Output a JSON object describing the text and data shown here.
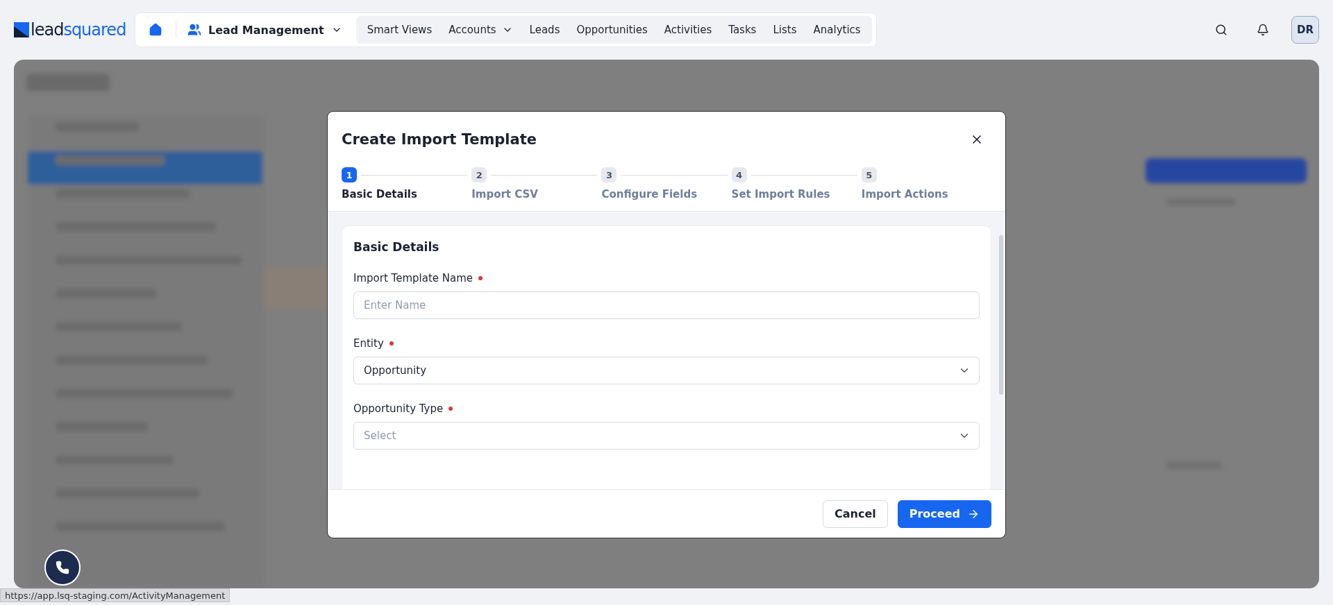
{
  "nav": {
    "logo_parts": [
      "lead",
      "squared"
    ],
    "app": "Lead Management",
    "items": [
      {
        "label": "Smart Views",
        "dropdown": false
      },
      {
        "label": "Accounts",
        "dropdown": true
      },
      {
        "label": "Leads",
        "dropdown": false
      },
      {
        "label": "Opportunities",
        "dropdown": false
      },
      {
        "label": "Activities",
        "dropdown": false
      },
      {
        "label": "Tasks",
        "dropdown": false
      },
      {
        "label": "Lists",
        "dropdown": false
      },
      {
        "label": "Analytics",
        "dropdown": false
      }
    ],
    "user_initials": "DR"
  },
  "dialog": {
    "title": "Create Import Template",
    "steps": [
      {
        "number": "1",
        "label": "Basic Details",
        "selected": true
      },
      {
        "number": "2",
        "label": "Import CSV",
        "selected": false
      },
      {
        "number": "3",
        "label": "Configure Fields",
        "selected": false
      },
      {
        "number": "4",
        "label": "Set Import Rules",
        "selected": false
      },
      {
        "number": "5",
        "label": "Import Actions",
        "selected": false
      }
    ],
    "section_title": "Basic Details",
    "fields": [
      {
        "kind": "text",
        "label": "Import Template Name",
        "required": true,
        "placeholder": "Enter Name"
      },
      {
        "kind": "select",
        "label": "Entity",
        "required": true,
        "value": "Opportunity"
      },
      {
        "kind": "select",
        "label": "Opportunity Type",
        "required": true,
        "placeholder": "Select"
      }
    ],
    "buttons": [
      {
        "label": "Cancel",
        "kind": "secondary"
      },
      {
        "label": "Proceed",
        "kind": "primary"
      }
    ]
  },
  "status_url": "https://app.lsq-staging.com/ActivityManagement"
}
